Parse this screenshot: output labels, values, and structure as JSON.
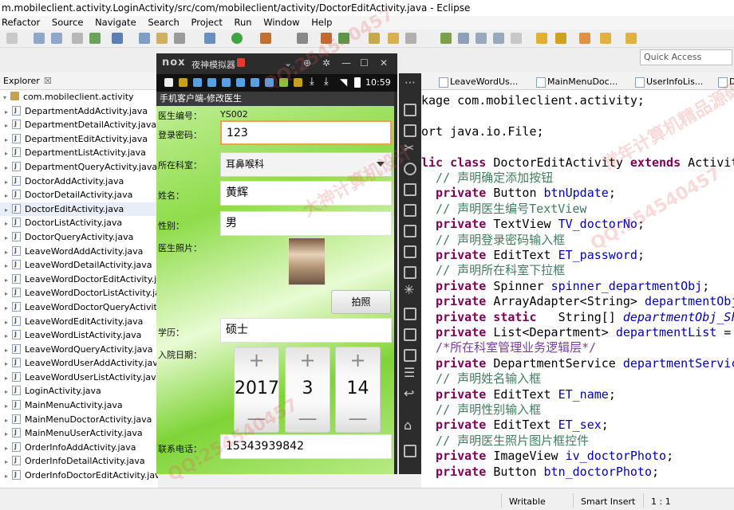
{
  "window": {
    "title": "m.mobileclient.activity.LoginActivity/src/com/mobileclient/activity/DoctorEditActivity.java - Eclipse"
  },
  "menu": [
    "Refactor",
    "Source",
    "Navigate",
    "Search",
    "Project",
    "Run",
    "Window",
    "Help"
  ],
  "quick_access": {
    "placeholder": "Quick Access"
  },
  "explorer": {
    "title": "Explorer",
    "close": "☒",
    "package": "com.mobileclient.activity",
    "files": [
      "DepartmentAddActivity.java",
      "DepartmentDetailActivity.java",
      "DepartmentEditActivity.java",
      "DepartmentListActivity.java",
      "DepartmentQueryActivity.java",
      "DoctorAddActivity.java",
      "DoctorDetailActivity.java",
      "DoctorEditActivity.java",
      "DoctorListActivity.java",
      "DoctorQueryActivity.java",
      "LeaveWordAddActivity.java",
      "LeaveWordDetailActivity.java",
      "LeaveWordDoctorEditActivity.java",
      "LeaveWordDoctorListActivity.java",
      "LeaveWordDoctorQueryActivity.java",
      "LeaveWordEditActivity.java",
      "LeaveWordListActivity.java",
      "LeaveWordQueryActivity.java",
      "LeaveWordUserAddActivity.java",
      "LeaveWordUserListActivity.java",
      "LoginActivity.java",
      "MainMenuActivity.java",
      "MainMenuDoctorActivity.java",
      "MainMenuUserActivity.java",
      "OrderInfoAddActivity.java",
      "OrderInfoDetailActivity.java",
      "OrderInfoDoctorEditActivity.java"
    ],
    "selected_index": 7
  },
  "editor_tabs": [
    "LeaveWordUs...",
    "MainMenuDoc...",
    "UserInfoLis...",
    "D"
  ],
  "code": [
    {
      "parts": [
        [
          "",
          "kage com.mobileclient.activity;"
        ]
      ]
    },
    {
      "parts": []
    },
    {
      "parts": [
        [
          "",
          "ort java.io.File;"
        ]
      ]
    },
    {
      "parts": []
    },
    {
      "parts": [
        [
          "kw",
          "lic class "
        ],
        [
          "",
          "DoctorEditActivity "
        ],
        [
          "kw",
          "extends "
        ],
        [
          "",
          "Activity"
        ]
      ]
    },
    {
      "parts": [
        [
          "cm",
          "  // 声明确定添加按钮"
        ]
      ]
    },
    {
      "parts": [
        [
          "kw",
          "  private "
        ],
        [
          "",
          "Button "
        ],
        [
          "fld",
          "btnUpdate"
        ],
        [
          "",
          ";"
        ]
      ]
    },
    {
      "parts": [
        [
          "cm",
          "  // 声明医生编号TextView"
        ]
      ]
    },
    {
      "parts": [
        [
          "kw",
          "  private "
        ],
        [
          "",
          "TextView "
        ],
        [
          "fld",
          "TV_doctorNo"
        ],
        [
          "",
          ";"
        ]
      ]
    },
    {
      "parts": [
        [
          "cm",
          "  // 声明登录密码输入框"
        ]
      ]
    },
    {
      "parts": [
        [
          "kw",
          "  private "
        ],
        [
          "",
          "EditText "
        ],
        [
          "fld",
          "ET_password"
        ],
        [
          "",
          ";"
        ]
      ]
    },
    {
      "parts": [
        [
          "cm",
          "  // 声明所在科室下拉框"
        ]
      ]
    },
    {
      "parts": [
        [
          "kw",
          "  private "
        ],
        [
          "",
          "Spinner "
        ],
        [
          "fld",
          "spinner_departmentObj"
        ],
        [
          "",
          ";"
        ]
      ]
    },
    {
      "parts": [
        [
          "kw",
          "  private "
        ],
        [
          "",
          "ArrayAdapter<String> "
        ],
        [
          "fld",
          "departmentObj_a"
        ]
      ]
    },
    {
      "parts": [
        [
          "kw",
          "  private static "
        ],
        [
          "",
          "  String[] "
        ],
        [
          "fldi",
          "departmentObj_ShowT"
        ]
      ]
    },
    {
      "parts": [
        [
          "kw",
          "  private "
        ],
        [
          "",
          "List<Department> "
        ],
        [
          "fld",
          "departmentList"
        ],
        [
          "",
          " = nu"
        ]
      ]
    },
    {
      "parts": [
        [
          "sc",
          "  /*所在科室管理业务逻辑层*/"
        ]
      ]
    },
    {
      "parts": [
        [
          "kw",
          "  private "
        ],
        [
          "",
          "DepartmentService "
        ],
        [
          "fld",
          "departmentService"
        ]
      ]
    },
    {
      "parts": [
        [
          "cm",
          "  // 声明姓名输入框"
        ]
      ]
    },
    {
      "parts": [
        [
          "kw",
          "  private "
        ],
        [
          "",
          "EditText "
        ],
        [
          "fld",
          "ET_name"
        ],
        [
          "",
          ";"
        ]
      ]
    },
    {
      "parts": [
        [
          "cm",
          "  // 声明性别输入框"
        ]
      ]
    },
    {
      "parts": [
        [
          "kw",
          "  private "
        ],
        [
          "",
          "EditText "
        ],
        [
          "fld",
          "ET_sex"
        ],
        [
          "",
          ";"
        ]
      ]
    },
    {
      "parts": [
        [
          "cm",
          "  // 声明医生照片图片框控件"
        ]
      ]
    },
    {
      "parts": [
        [
          "kw",
          "  private "
        ],
        [
          "",
          "ImageView "
        ],
        [
          "fld",
          "iv_doctorPhoto"
        ],
        [
          "",
          ";"
        ]
      ]
    },
    {
      "parts": [
        [
          "kw",
          "  private "
        ],
        [
          "",
          "Button "
        ],
        [
          "fld",
          "btn_doctorPhoto"
        ],
        [
          "",
          ";"
        ]
      ]
    }
  ],
  "status": {
    "writable": "Writable",
    "insert": "Smart Insert",
    "position": "1 : 1"
  },
  "emulator": {
    "logo": "nox",
    "title": "夜神模拟器",
    "clock": "10:59",
    "app_title": "手机客户端-修改医生",
    "fields": {
      "doctor_no_label": "医生编号：",
      "doctor_no_value": "YS002",
      "password_label": "登录密码：",
      "password_value": "123",
      "department_label": "所在科室：",
      "department_value": "耳鼻喉科",
      "name_label": "姓名：",
      "name_value": "黄辉",
      "sex_label": "性别：",
      "sex_value": "男",
      "photo_label": "医生照片：",
      "photo_button": "拍照",
      "education_label": "学历：",
      "education_value": "硕士",
      "join_date_label": "入院日期：",
      "date_year": "2017",
      "date_month": "3",
      "date_day": "14",
      "picker_plus": "+",
      "picker_minus": "—",
      "phone_label": "联系电话：",
      "phone_value": "15343939842"
    }
  },
  "watermarks": [
    "QQ:254540457",
    "大神计算机设计",
    "常年计算机精品源码设计"
  ]
}
